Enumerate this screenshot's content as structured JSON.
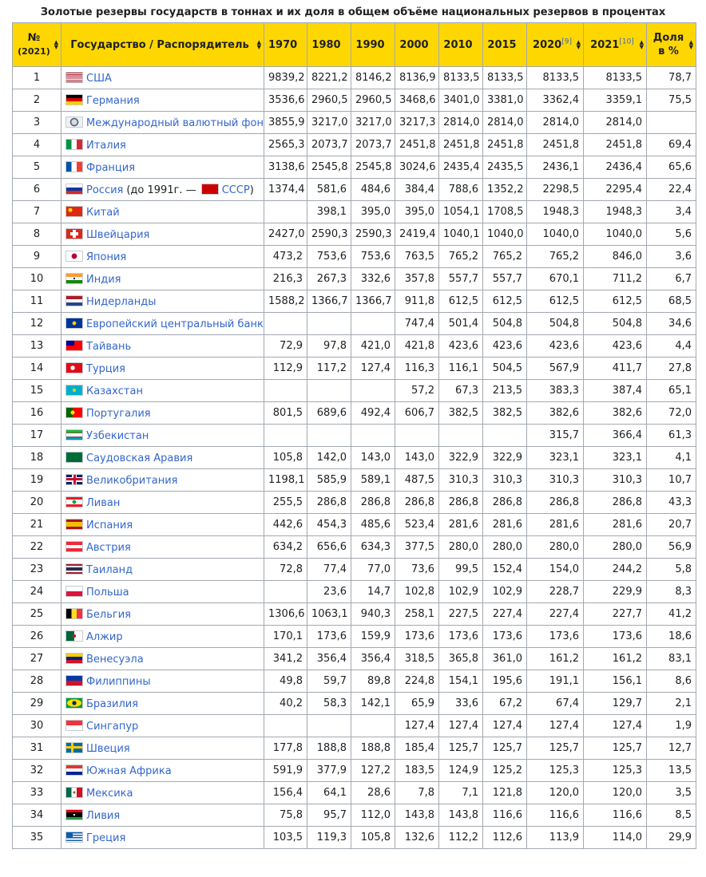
{
  "caption": "Золотые резервы государств в тоннах и их доля в общем объёме национальных резервов в процентах",
  "headers": {
    "rank_top": "№",
    "rank_bottom": "(2021)",
    "country": "Государство / Распорядитель",
    "y1970": "1970",
    "y1980": "1980",
    "y1990": "1990",
    "y2000": "2000",
    "y2010": "2010",
    "y2015": "2015",
    "y2020": "2020",
    "y2020_ref": "[9]",
    "y2021": "2021",
    "y2021_ref": "[10]",
    "share_top": "Доля",
    "share_bottom": "в %"
  },
  "colors": {
    "header_bg": "#ffd700",
    "border": "#a2a9b1",
    "link": "#3366cc"
  },
  "rows": [
    {
      "rank": "1",
      "country": "США",
      "flag": "flag-usa",
      "v": [
        "9839,2",
        "8221,2",
        "8146,2",
        "8136,9",
        "8133,5",
        "8133,5",
        "8133,5",
        "8133,5",
        "78,7"
      ]
    },
    {
      "rank": "2",
      "country": "Германия",
      "flag": "flag-germany",
      "v": [
        "3536,6",
        "2960,5",
        "2960,5",
        "3468,6",
        "3401,0",
        "3381,0",
        "3362,4",
        "3359,1",
        "75,5"
      ]
    },
    {
      "rank": "3",
      "country": "Международный валютный фонд",
      "flag": "flag-imf",
      "v": [
        "3855,9",
        "3217,0",
        "3217,0",
        "3217,3",
        "2814,0",
        "2814,0",
        "2814,0",
        "2814,0",
        ""
      ]
    },
    {
      "rank": "4",
      "country": "Италия",
      "flag": "flag-italy",
      "v": [
        "2565,3",
        "2073,7",
        "2073,7",
        "2451,8",
        "2451,8",
        "2451,8",
        "2451,8",
        "2451,8",
        "69,4"
      ]
    },
    {
      "rank": "5",
      "country": "Франция",
      "flag": "flag-france",
      "v": [
        "3138,6",
        "2545,8",
        "2545,8",
        "3024,6",
        "2435,4",
        "2435,5",
        "2436,1",
        "2436,4",
        "65,6"
      ]
    },
    {
      "rank": "6",
      "country": "Россия",
      "note": "(до 1991г. —",
      "country2": "СССР",
      "note2": ")",
      "flag": "flag-russia",
      "flag2": "flag-ussr",
      "v": [
        "1374,4",
        "581,6",
        "484,6",
        "384,4",
        "788,6",
        "1352,2",
        "2298,5",
        "2295,4",
        "22,4"
      ]
    },
    {
      "rank": "7",
      "country": "Китай",
      "flag": "flag-china",
      "v": [
        "",
        "398,1",
        "395,0",
        "395,0",
        "1054,1",
        "1708,5",
        "1948,3",
        "1948,3",
        "3,4"
      ]
    },
    {
      "rank": "8",
      "country": "Швейцария",
      "flag": "flag-switzerland",
      "v": [
        "2427,0",
        "2590,3",
        "2590,3",
        "2419,4",
        "1040,1",
        "1040,0",
        "1040,0",
        "1040,0",
        "5,6"
      ]
    },
    {
      "rank": "9",
      "country": "Япония",
      "flag": "flag-japan",
      "v": [
        "473,2",
        "753,6",
        "753,6",
        "763,5",
        "765,2",
        "765,2",
        "765,2",
        "846,0",
        "3,6"
      ]
    },
    {
      "rank": "10",
      "country": "Индия",
      "flag": "flag-india",
      "v": [
        "216,3",
        "267,3",
        "332,6",
        "357,8",
        "557,7",
        "557,7",
        "670,1",
        "711,2",
        "6,7"
      ]
    },
    {
      "rank": "11",
      "country": "Нидерланды",
      "flag": "flag-netherlands",
      "v": [
        "1588,2",
        "1366,7",
        "1366,7",
        "911,8",
        "612,5",
        "612,5",
        "612,5",
        "612,5",
        "68,5"
      ]
    },
    {
      "rank": "12",
      "country": "Европейский центральный банк",
      "flag": "flag-ecb",
      "v": [
        "",
        "",
        "",
        "747,4",
        "501,4",
        "504,8",
        "504,8",
        "504,8",
        "34,6"
      ]
    },
    {
      "rank": "13",
      "country": "Тайвань",
      "flag": "flag-taiwan",
      "v": [
        "72,9",
        "97,8",
        "421,0",
        "421,8",
        "423,6",
        "423,6",
        "423,6",
        "423,6",
        "4,4"
      ]
    },
    {
      "rank": "14",
      "country": "Турция",
      "flag": "flag-turkey",
      "v": [
        "112,9",
        "117,2",
        "127,4",
        "116,3",
        "116,1",
        "504,5",
        "567,9",
        "411,7",
        "27,8"
      ]
    },
    {
      "rank": "15",
      "country": "Казахстан",
      "flag": "flag-kazakhstan",
      "v": [
        "",
        "",
        "",
        "57,2",
        "67,3",
        "213,5",
        "383,3",
        "387,4",
        "65,1"
      ]
    },
    {
      "rank": "16",
      "country": "Португалия",
      "flag": "flag-portugal",
      "v": [
        "801,5",
        "689,6",
        "492,4",
        "606,7",
        "382,5",
        "382,5",
        "382,6",
        "382,6",
        "72,0"
      ]
    },
    {
      "rank": "17",
      "country": "Узбекистан",
      "flag": "flag-uzbekistan",
      "v": [
        "",
        "",
        "",
        "",
        "",
        "",
        "315,7",
        "366,4",
        "61,3"
      ]
    },
    {
      "rank": "18",
      "country": "Саудовская Аравия",
      "flag": "flag-saudi-arabia",
      "v": [
        "105,8",
        "142,0",
        "143,0",
        "143,0",
        "322,9",
        "322,9",
        "323,1",
        "323,1",
        "4,1"
      ]
    },
    {
      "rank": "19",
      "country": "Великобритания",
      "flag": "flag-uk",
      "v": [
        "1198,1",
        "585,9",
        "589,1",
        "487,5",
        "310,3",
        "310,3",
        "310,3",
        "310,3",
        "10,7"
      ]
    },
    {
      "rank": "20",
      "country": "Ливан",
      "flag": "flag-lebanon",
      "v": [
        "255,5",
        "286,8",
        "286,8",
        "286,8",
        "286,8",
        "286,8",
        "286,8",
        "286,8",
        "43,3"
      ]
    },
    {
      "rank": "21",
      "country": "Испания",
      "flag": "flag-spain",
      "v": [
        "442,6",
        "454,3",
        "485,6",
        "523,4",
        "281,6",
        "281,6",
        "281,6",
        "281,6",
        "20,7"
      ]
    },
    {
      "rank": "22",
      "country": "Австрия",
      "flag": "flag-austria",
      "v": [
        "634,2",
        "656,6",
        "634,3",
        "377,5",
        "280,0",
        "280,0",
        "280,0",
        "280,0",
        "56,9"
      ]
    },
    {
      "rank": "23",
      "country": "Таиланд",
      "flag": "flag-thailand",
      "v": [
        "72,8",
        "77,4",
        "77,0",
        "73,6",
        "99,5",
        "152,4",
        "154,0",
        "244,2",
        "5,8"
      ]
    },
    {
      "rank": "24",
      "country": "Польша",
      "flag": "flag-poland",
      "v": [
        "",
        "23,6",
        "14,7",
        "102,8",
        "102,9",
        "102,9",
        "228,7",
        "229,9",
        "8,3"
      ]
    },
    {
      "rank": "25",
      "country": "Бельгия",
      "flag": "flag-belgium",
      "v": [
        "1306,6",
        "1063,1",
        "940,3",
        "258,1",
        "227,5",
        "227,4",
        "227,4",
        "227,7",
        "41,2"
      ]
    },
    {
      "rank": "26",
      "country": "Алжир",
      "flag": "flag-algeria",
      "v": [
        "170,1",
        "173,6",
        "159,9",
        "173,6",
        "173,6",
        "173,6",
        "173,6",
        "173,6",
        "18,6"
      ]
    },
    {
      "rank": "27",
      "country": "Венесуэла",
      "flag": "flag-venezuela",
      "v": [
        "341,2",
        "356,4",
        "356,4",
        "318,5",
        "365,8",
        "361,0",
        "161,2",
        "161,2",
        "83,1"
      ]
    },
    {
      "rank": "28",
      "country": "Филиппины",
      "flag": "flag-philippines",
      "v": [
        "49,8",
        "59,7",
        "89,8",
        "224,8",
        "154,1",
        "195,6",
        "191,1",
        "156,1",
        "8,6"
      ]
    },
    {
      "rank": "29",
      "country": "Бразилия",
      "flag": "flag-brazil",
      "v": [
        "40,2",
        "58,3",
        "142,1",
        "65,9",
        "33,6",
        "67,2",
        "67,4",
        "129,7",
        "2,1"
      ]
    },
    {
      "rank": "30",
      "country": "Сингапур",
      "flag": "flag-singapore",
      "v": [
        "",
        "",
        "",
        "127,4",
        "127,4",
        "127,4",
        "127,4",
        "127,4",
        "1,9"
      ]
    },
    {
      "rank": "31",
      "country": "Швеция",
      "flag": "flag-sweden",
      "v": [
        "177,8",
        "188,8",
        "188,8",
        "185,4",
        "125,7",
        "125,7",
        "125,7",
        "125,7",
        "12,7"
      ]
    },
    {
      "rank": "32",
      "country": "Южная Африка",
      "flag": "flag-south-africa",
      "v": [
        "591,9",
        "377,9",
        "127,2",
        "183,5",
        "124,9",
        "125,2",
        "125,3",
        "125,3",
        "13,5"
      ]
    },
    {
      "rank": "33",
      "country": "Мексика",
      "flag": "flag-mexico",
      "v": [
        "156,4",
        "64,1",
        "28,6",
        "7,8",
        "7,1",
        "121,8",
        "120,0",
        "120,0",
        "3,5"
      ]
    },
    {
      "rank": "34",
      "country": "Ливия",
      "flag": "flag-libya",
      "v": [
        "75,8",
        "95,7",
        "112,0",
        "143,8",
        "143,8",
        "116,6",
        "116,6",
        "116,6",
        "8,5"
      ]
    },
    {
      "rank": "35",
      "country": "Греция",
      "flag": "flag-greece",
      "v": [
        "103,5",
        "119,3",
        "105,8",
        "132,6",
        "112,2",
        "112,6",
        "113,9",
        "114,0",
        "29,9"
      ]
    }
  ]
}
